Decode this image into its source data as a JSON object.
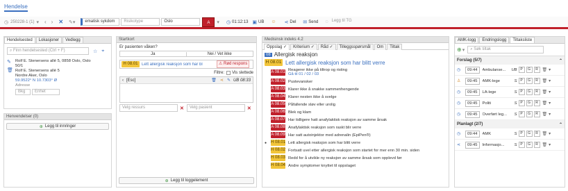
{
  "app": {
    "title": "Hendelse"
  },
  "toolbar": {
    "case_id": "250228-1 (1)",
    "incident_type": "ematisk sykdom",
    "priority_placeholder": "Risikotype",
    "location": "Oslo",
    "priority_badge": "A",
    "time": "01:12:13",
    "unit": "UB",
    "del_label": "Del",
    "send_label": "Send",
    "search_placeholder": "Legg til TG"
  },
  "left": {
    "tabs": [
      "Hendelsested",
      "Lokasjoner",
      "Vedlegg"
    ],
    "search_placeholder": "Finn hendelsested (Ctrl + F)",
    "address_lines": [
      "Rolf E. Stenersens allé 5, 0858 Oslo, Oslo",
      "50/1",
      "Rolf E. Stenersens allé 5",
      "Nordre Aker, Oslo"
    ],
    "coords": "59.9522° N 10.7303° Ø",
    "address_label": "Adresse",
    "field1": "Bkg",
    "field2": "Enhet",
    "henv_header": "Henvendelser (0)",
    "add_call": "Legg til innringer"
  },
  "middle": {
    "header": "Startkort",
    "question": "Er pasienten våken?",
    "opt_yes": "Ja",
    "opt_no": "Nei / Vet ikke",
    "code": "H 08.01",
    "code_text": "Lett allergisk reaksjon som har bl",
    "urgent": "Rød respons",
    "filter": "Filtre:",
    "show_deleted": "Vis slettede",
    "esc": "[Esc]",
    "ub_time": "UB 08:33",
    "resource_placeholder": "Velg ressurs",
    "patient_placeholder": "Velg pasient",
    "add_log": "Legg til loggelement"
  },
  "index": {
    "header": "Medisinsk indeks 4.2",
    "tabs": [
      "Oppslag",
      "Kriterium",
      "Råd",
      "Tilleggsspørsmål",
      "Om",
      "Tiltak"
    ],
    "badge": "08",
    "title": "Allergisk reaksjon",
    "main_code": "H 08.01",
    "main_text": "Lett allergisk reaksjon som har blitt verre",
    "items": [
      {
        "code": "A 08.01",
        "color": "red",
        "text": "Reagerer ikke på tiltrop og risting",
        "sub": "Gå til 01 / 02 / 03"
      },
      {
        "code": "A 08.02",
        "color": "red",
        "text": "Pustevansker"
      },
      {
        "code": "A 08.03",
        "color": "red",
        "text": "Klarer ikke å snakke sammenhengende"
      },
      {
        "code": "A 08.04",
        "color": "red",
        "text": "Klarer nesten ikke å svelge"
      },
      {
        "code": "A 08.05",
        "color": "red",
        "text": "Påfallende sløv eller urolig"
      },
      {
        "code": "A 08.06",
        "color": "red",
        "text": "Blek og klam"
      },
      {
        "code": "A 08.07",
        "color": "red",
        "text": "Har tidligere hatt anafylaktisk reaksjon av samme årsak"
      },
      {
        "code": "A 08.08",
        "color": "red",
        "text": "Anafylaktisk reaksjon som raskt blir verre"
      },
      {
        "code": "A 08.09",
        "color": "red",
        "text": "Har satt autoinjektor med adrenalin (EpiPen®)"
      },
      {
        "code": "H 08.01",
        "color": "yellow",
        "text": "Lett allergisk reaksjon som har blitt verre"
      },
      {
        "code": "H 08.02",
        "color": "yellow",
        "text": "Fortsatt uvel etter allergisk reaksjon som startet for mer enn 30 min. siden"
      },
      {
        "code": "H 08.03",
        "color": "yellow",
        "text": "Redd for å utvikle ny reaksjon av samme årsak som opplevd før"
      },
      {
        "code": "H 08.04",
        "color": "yellow",
        "text": "Andre symptomer knyttet til oppslaget"
      }
    ]
  },
  "right": {
    "tabs": [
      "AMK-logg",
      "Endringslogg",
      "Tiltaksliste"
    ],
    "search_placeholder": "Søk tiltak",
    "forslag_header": "Forslag (5/7)",
    "forslag": [
      {
        "time": "09:44",
        "name": "Ambulanse...",
        "status": "UB"
      },
      {
        "time": "09:45",
        "name": "AMK-lege",
        "status": "S"
      },
      {
        "time": "09:45",
        "name": "LA-lege",
        "status": "S"
      },
      {
        "time": "09:45",
        "name": "Politi",
        "status": "S"
      },
      {
        "time": "09:45",
        "name": "Overført leg...",
        "status": "S"
      }
    ],
    "planlagt_header": "Planlagt (2/7)",
    "planlagt": [
      {
        "time": "09:44",
        "name": "AMK",
        "status": "S"
      },
      {
        "time": "09:45",
        "name": "Informasjo...",
        "status": "S"
      }
    ],
    "buttons": [
      "P",
      "G",
      "R"
    ]
  },
  "colors": {
    "accent": "#c0202b",
    "blue": "#3a6fbf",
    "yellow": "#f2c53a"
  }
}
